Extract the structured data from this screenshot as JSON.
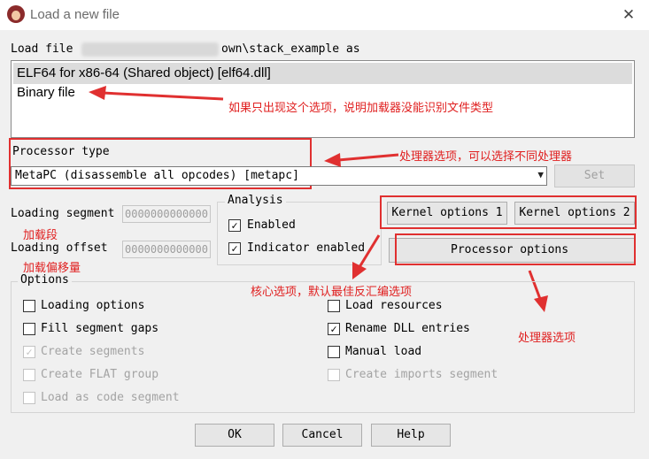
{
  "window": {
    "title": "Load a new file"
  },
  "load_file": {
    "prefix": "Load file",
    "suffix": "own\\stack_example as"
  },
  "file_types": [
    {
      "label": "ELF64 for x86-64 (Shared object) [elf64.dll]",
      "selected": true
    },
    {
      "label": "Binary file",
      "selected": false
    }
  ],
  "processor": {
    "label": "Processor type",
    "value": "MetaPC (disassemble all opcodes) [metapc]",
    "set_button": "Set"
  },
  "loading_segment": {
    "label": "Loading segment",
    "value": "0000000000000"
  },
  "loading_offset": {
    "label": "Loading offset",
    "value": "0000000000000"
  },
  "analysis": {
    "title": "Analysis",
    "enabled": {
      "label": "Enabled",
      "checked": true
    },
    "indicator": {
      "label": "Indicator enabled",
      "checked": true
    }
  },
  "kernel_buttons": {
    "k1": "Kernel options 1",
    "k2": "Kernel options 2",
    "processor_options": "Processor options"
  },
  "options": {
    "title": "Options",
    "loading_options": "Loading options",
    "fill_segment_gaps": "Fill segment gaps",
    "create_segments": "Create segments",
    "create_flat_group": "Create FLAT group",
    "load_as_code_segment": "Load as code segment",
    "load_resources": "Load resources",
    "rename_dll_entries": "Rename DLL entries",
    "manual_load": "Manual load",
    "create_imports_segment": "Create imports segment"
  },
  "buttons": {
    "ok": "OK",
    "cancel": "Cancel",
    "help": "Help"
  },
  "annotations": {
    "binary_note": "如果只出现这个选项，说明加载器没能识别文件类型",
    "processor_note": "处理器选项，可以选择不同处理器",
    "segment_note": "加载段",
    "offset_note": "加载偏移量",
    "kernel_note": "核心选项，默认最佳反汇编选项",
    "procopt_note": "处理器选项"
  },
  "colors": {
    "annotation": "#e02020",
    "selection": "#dcdcdc"
  }
}
